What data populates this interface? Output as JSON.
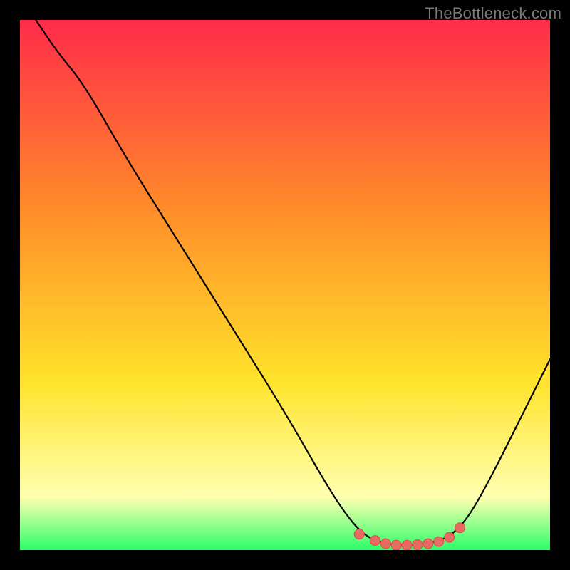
{
  "watermark": "TheBottleneck.com",
  "colors": {
    "gradient_top": "#ff2b4a",
    "gradient_mid1": "#ff8a2a",
    "gradient_mid2": "#ffe32a",
    "gradient_pale": "#ffffb0",
    "gradient_bottom": "#2bff6a",
    "curve": "#000000",
    "marker_fill": "#e86b63",
    "marker_stroke": "#d94f47",
    "frame": "#000000"
  },
  "chart_data": {
    "type": "line",
    "title": "",
    "xlabel": "",
    "ylabel": "",
    "xlim": [
      0,
      100
    ],
    "ylim": [
      0,
      100
    ],
    "curve": [
      {
        "x": 3,
        "y": 100
      },
      {
        "x": 7,
        "y": 94
      },
      {
        "x": 12,
        "y": 88
      },
      {
        "x": 20,
        "y": 74
      },
      {
        "x": 30,
        "y": 58
      },
      {
        "x": 40,
        "y": 42
      },
      {
        "x": 50,
        "y": 26
      },
      {
        "x": 58,
        "y": 12
      },
      {
        "x": 62,
        "y": 6
      },
      {
        "x": 65,
        "y": 2.8
      },
      {
        "x": 68,
        "y": 1.4
      },
      {
        "x": 71,
        "y": 0.9
      },
      {
        "x": 74,
        "y": 0.9
      },
      {
        "x": 77,
        "y": 1.2
      },
      {
        "x": 80,
        "y": 2.0
      },
      {
        "x": 83,
        "y": 4.2
      },
      {
        "x": 86,
        "y": 8.5
      },
      {
        "x": 90,
        "y": 16
      },
      {
        "x": 95,
        "y": 26
      },
      {
        "x": 100,
        "y": 36
      }
    ],
    "markers": [
      {
        "x": 64,
        "y": 3.0
      },
      {
        "x": 67,
        "y": 1.8
      },
      {
        "x": 69,
        "y": 1.2
      },
      {
        "x": 71,
        "y": 0.9
      },
      {
        "x": 73,
        "y": 0.9
      },
      {
        "x": 75,
        "y": 1.0
      },
      {
        "x": 77,
        "y": 1.2
      },
      {
        "x": 79,
        "y": 1.6
      },
      {
        "x": 81,
        "y": 2.4
      },
      {
        "x": 83,
        "y": 4.2
      }
    ]
  }
}
